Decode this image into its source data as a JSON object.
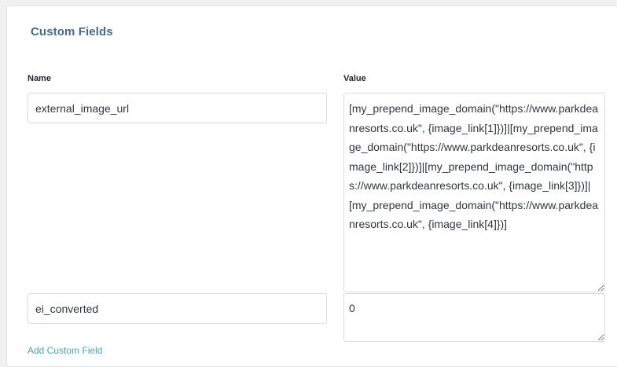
{
  "panel": {
    "title": "Custom Fields"
  },
  "columns": {
    "name_label": "Name",
    "value_label": "Value"
  },
  "fields": [
    {
      "name": "external_image_url",
      "value": "[my_prepend_image_domain(\"https://www.parkdeanresorts.co.uk\", {image_link[1]})]|[my_prepend_image_domain(\"https://www.parkdeanresorts.co.uk\", {image_link[2]})]|[my_prepend_image_domain(\"https://www.parkdeanresorts.co.uk\", {image_link[3]})]|[my_prepend_image_domain(\"https://www.parkdeanresorts.co.uk\", {image_link[4]})]"
    },
    {
      "name": "ei_converted",
      "value": "0"
    }
  ],
  "actions": {
    "add_label": "Add Custom Field"
  }
}
